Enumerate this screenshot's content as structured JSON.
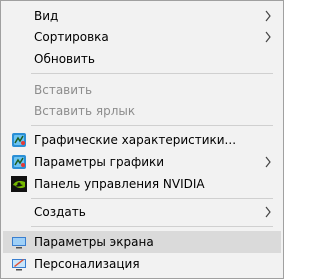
{
  "menu": {
    "items": [
      {
        "label": "Вид",
        "icon": null,
        "submenu": true,
        "disabled": false
      },
      {
        "label": "Сортировка",
        "icon": null,
        "submenu": true,
        "disabled": false
      },
      {
        "label": "Обновить",
        "icon": null,
        "submenu": false,
        "disabled": false
      },
      {
        "label": "Вставить",
        "icon": null,
        "submenu": false,
        "disabled": true
      },
      {
        "label": "Вставить ярлык",
        "icon": null,
        "submenu": false,
        "disabled": true
      },
      {
        "label": "Графические характеристики...",
        "icon": "intel-graphics-icon",
        "submenu": false,
        "disabled": false
      },
      {
        "label": "Параметры графики",
        "icon": "intel-graphics-icon",
        "submenu": true,
        "disabled": false
      },
      {
        "label": "Панель управления NVIDIA",
        "icon": "nvidia-icon",
        "submenu": false,
        "disabled": false
      },
      {
        "label": "Создать",
        "icon": null,
        "submenu": true,
        "disabled": false
      },
      {
        "label": "Параметры экрана",
        "icon": "display-settings-icon",
        "submenu": false,
        "disabled": false,
        "highlighted": true
      },
      {
        "label": "Персонализация",
        "icon": "personalize-icon",
        "submenu": false,
        "disabled": false
      }
    ]
  },
  "colors": {
    "menu_bg": "#f2f2f2",
    "hover_bg": "#dadada",
    "disabled_text": "#8d8d8d",
    "separator": "#d0d0d0"
  }
}
